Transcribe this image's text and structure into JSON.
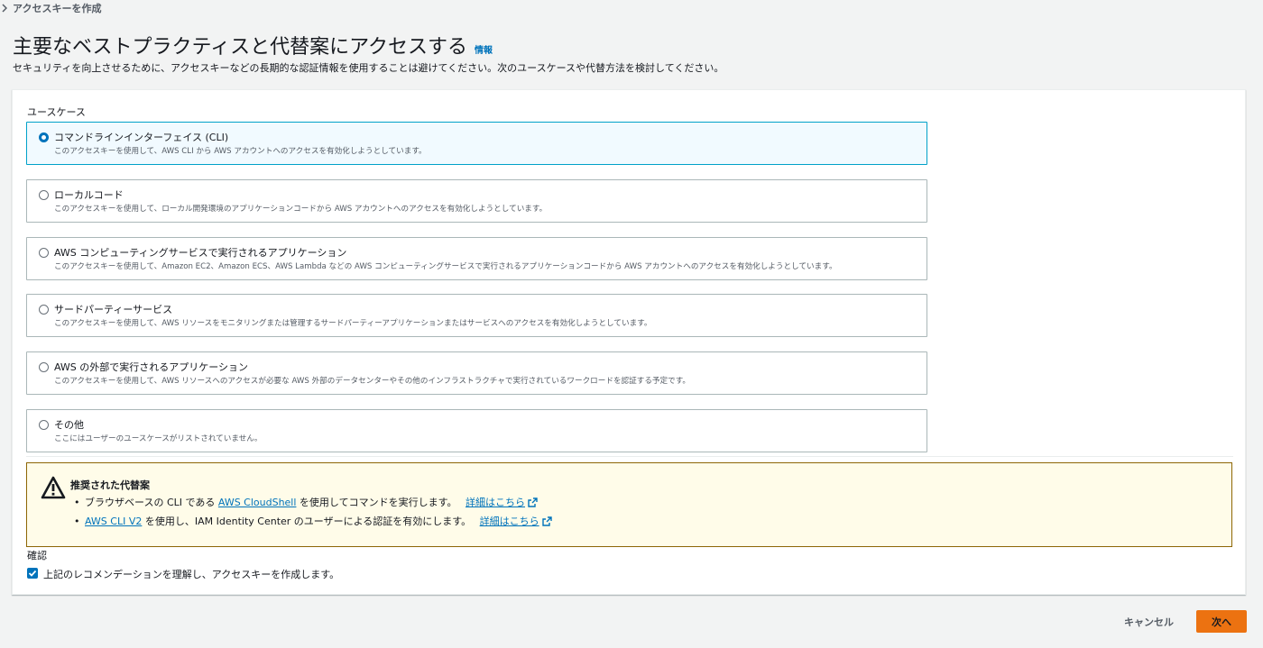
{
  "breadcrumb": {
    "label": "アクセスキーを作成"
  },
  "header": {
    "title": "主要なベストプラクティスと代替案にアクセスする",
    "info_link": "情報",
    "subtitle": "セキュリティを向上させるために、アクセスキーなどの長期的な認証情報を使用することは避けてください。次のユースケースや代替方法を検討してください。"
  },
  "use_case": {
    "label": "ユースケース",
    "selected_index": 0,
    "options": [
      {
        "title": "コマンドラインインターフェイス (CLI)",
        "desc": "このアクセスキーを使用して、AWS CLI から AWS アカウントへのアクセスを有効化しようとしています。"
      },
      {
        "title": "ローカルコード",
        "desc": "このアクセスキーを使用して、ローカル開発環境のアプリケーションコードから AWS アカウントへのアクセスを有効化しようとしています。"
      },
      {
        "title": "AWS コンピューティングサービスで実行されるアプリケーション",
        "desc": "このアクセスキーを使用して、Amazon EC2、Amazon ECS、AWS Lambda などの AWS コンピューティングサービスで実行されるアプリケーションコードから AWS アカウントへのアクセスを有効化しようとしています。"
      },
      {
        "title": "サードパーティーサービス",
        "desc": "このアクセスキーを使用して、AWS リソースをモニタリングまたは管理するサードパーティーアプリケーションまたはサービスへのアクセスを有効化しようとしています。"
      },
      {
        "title": "AWS の外部で実行されるアプリケーション",
        "desc": "このアクセスキーを使用して、AWS リソースへのアクセスが必要な AWS 外部のデータセンターやその他のインフラストラクチャで実行されているワークロードを認証する予定です。"
      },
      {
        "title": "その他",
        "desc": "ここにはユーザーのユースケースがリストされていません。"
      }
    ]
  },
  "alert": {
    "title": "推奨された代替案",
    "items": [
      {
        "pre": "ブラウザベースの CLI である",
        "link": "AWS CloudShell",
        "post": "を使用してコマンドを実行します。",
        "more": "詳細はこちら"
      },
      {
        "pre": "",
        "link": "AWS CLI V2",
        "post": "を使用し、IAM Identity Center のユーザーによる認証を有効にします。",
        "more": "詳細はこちら"
      }
    ],
    "icon": "warning-icon",
    "color": "#8d6605"
  },
  "confirm": {
    "label": "確認",
    "checkbox_text": "上記のレコメンデーションを理解し、アクセスキーを作成します。",
    "checked": true
  },
  "actions": {
    "cancel": "キャンセル",
    "next": "次へ"
  },
  "colors": {
    "accent": "#0073bb",
    "primary_button": "#ec7211",
    "selected_border": "#00a1c9"
  }
}
